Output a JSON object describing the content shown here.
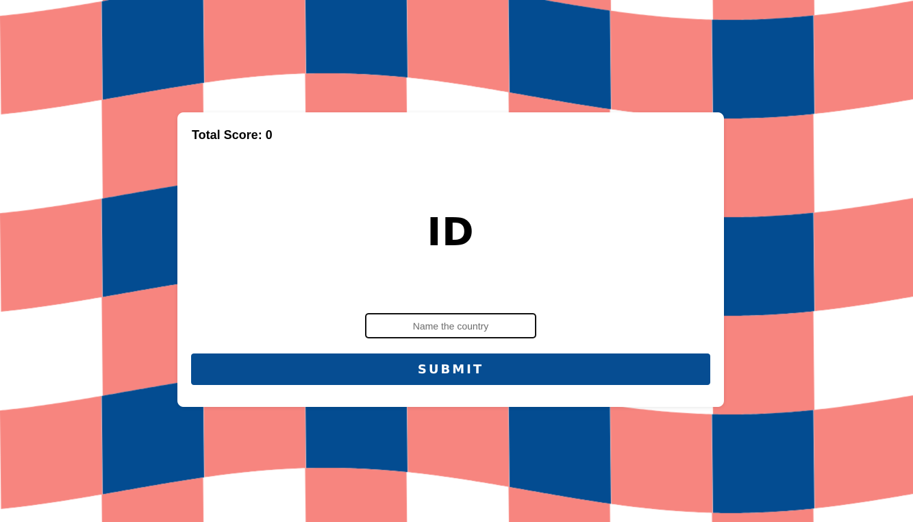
{
  "background": {
    "pattern": "wavy-checkered-flag",
    "colors": {
      "coral": "#f7857f",
      "navy": "#034c91",
      "white": "#ffffff"
    }
  },
  "game": {
    "score_text": "Total Score: 0",
    "country_code": "ID",
    "answer_value": "",
    "answer_placeholder": "Name the country",
    "submit_label": "SUBMIT"
  },
  "theme": {
    "button_color": "#064d92",
    "text_color": "#000000",
    "card_color": "#ffffff"
  }
}
